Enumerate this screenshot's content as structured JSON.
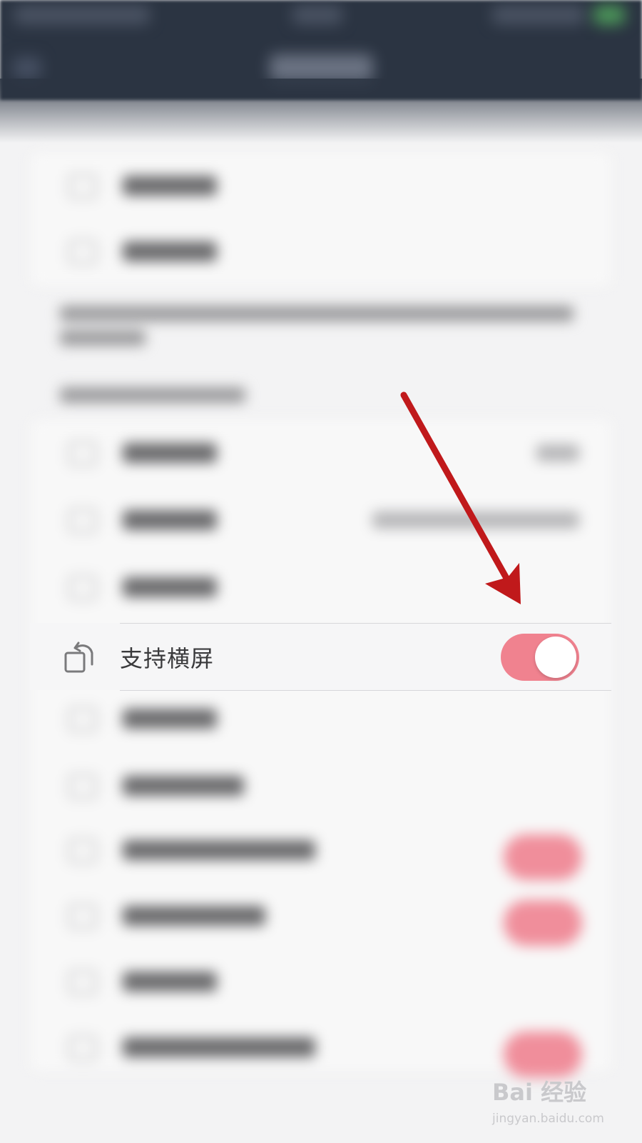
{
  "setting": {
    "label": "支持横屏",
    "icon": "rotate-screen-icon",
    "enabled": true
  },
  "colors": {
    "toggle_on": "#f0828f",
    "arrow": "#c0191b",
    "topbar": "#2b3442"
  },
  "watermark": {
    "brand": "Bai 经验",
    "url": "jingyan.baidu.com"
  }
}
